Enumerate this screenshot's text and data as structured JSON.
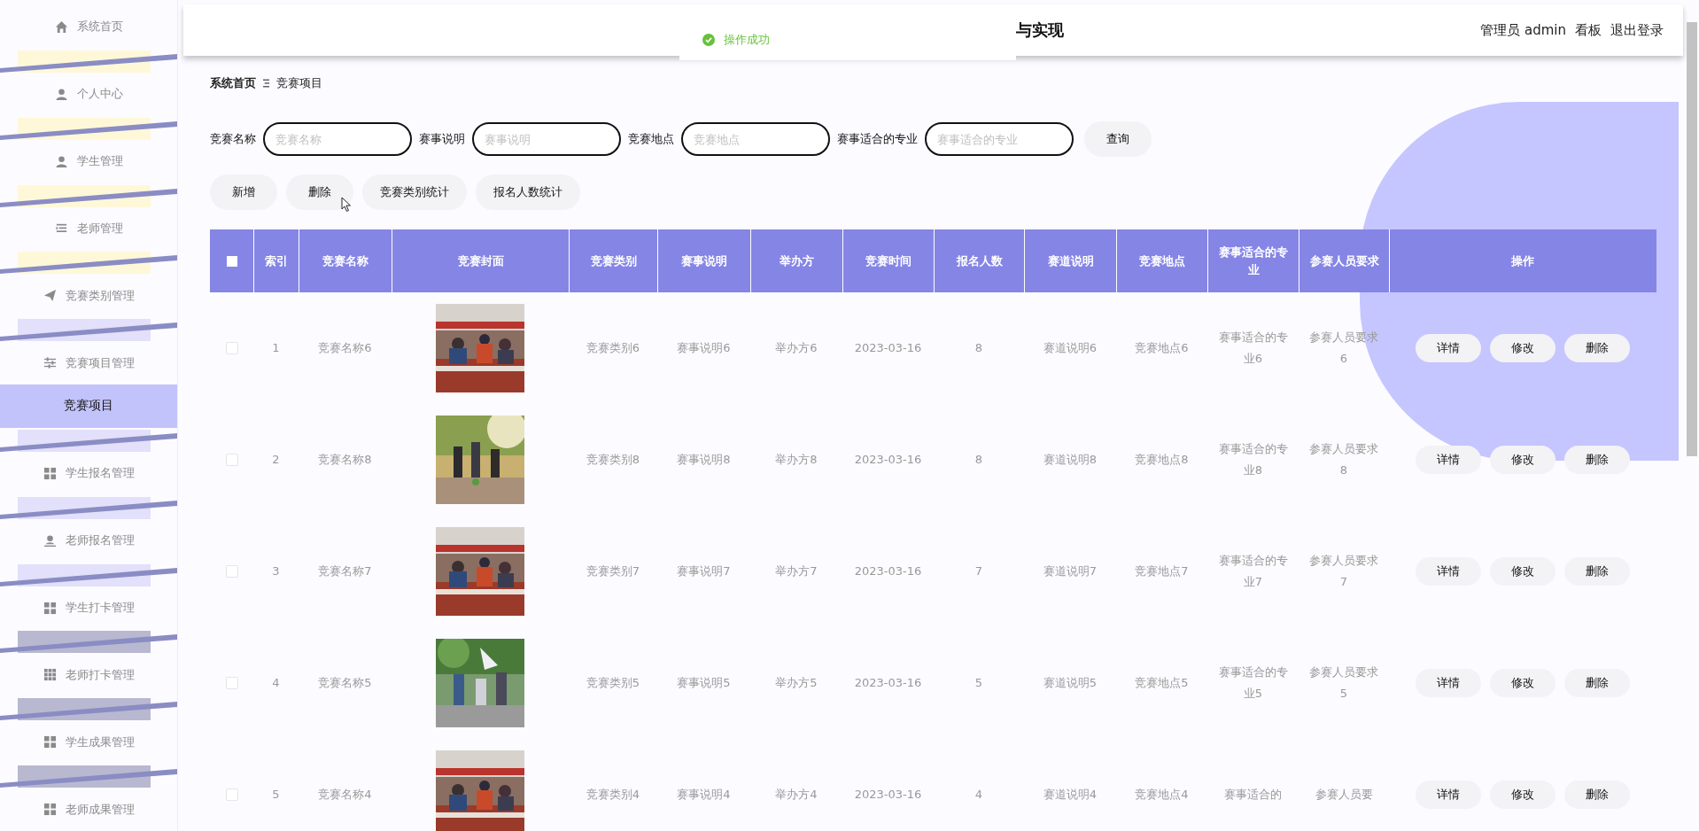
{
  "sidebar": {
    "items": [
      {
        "label": "系统首页",
        "selected": false
      },
      {
        "label": "个人中心",
        "selected": false
      },
      {
        "label": "学生管理",
        "selected": false
      },
      {
        "label": "老师管理",
        "selected": false
      },
      {
        "label": "竞赛类别管理",
        "selected": false
      },
      {
        "label": "竞赛项目管理",
        "selected": false,
        "expanded": true,
        "children": [
          {
            "label": "竞赛项目",
            "selected": true
          }
        ]
      },
      {
        "label": "学生报名管理",
        "selected": false
      },
      {
        "label": "老师报名管理",
        "selected": false
      },
      {
        "label": "学生打卡管理",
        "selected": false
      },
      {
        "label": "老师打卡管理",
        "selected": false
      },
      {
        "label": "学生成果管理",
        "selected": false
      },
      {
        "label": "老师成果管理",
        "selected": false
      }
    ]
  },
  "topbar": {
    "title": "与实现",
    "user": "管理员 admin",
    "links": [
      "看板",
      "退出登录"
    ]
  },
  "toast": {
    "message": "操作成功"
  },
  "breadcrumb": [
    "系统首页",
    "竞赛项目"
  ],
  "search": {
    "fields": [
      {
        "label": "竞赛名称",
        "placeholder": "竞赛名称"
      },
      {
        "label": "赛事说明",
        "placeholder": "赛事说明"
      },
      {
        "label": "竞赛地点",
        "placeholder": "竞赛地点"
      },
      {
        "label": "赛事适合的专业",
        "placeholder": "赛事适合的专业"
      }
    ],
    "button": "查询"
  },
  "actions": [
    "新增",
    "删除",
    "竞赛类别统计",
    "报名人数统计"
  ],
  "table": {
    "select_all": {
      "checked": false
    },
    "columns": [
      "索引",
      "竞赛名称",
      "竞赛封面",
      "竞赛类别",
      "赛事说明",
      "举办方",
      "竞赛时间",
      "报名人数",
      "赛道说明",
      "竞赛地点",
      "赛事适合的专业",
      "参赛人员要求",
      "操作"
    ],
    "rows": [
      {
        "checked": false,
        "index": "1",
        "name": "竞赛名称6",
        "cover": {
          "kind": "picture"
        },
        "category": "竞赛类别6",
        "description": "赛事说明6",
        "organizer": "举办方6",
        "date": "2023-03-16",
        "count": "8",
        "track": "赛道说明6",
        "location": "竞赛地点6",
        "major": "赛事适合的专业6",
        "requirement": "参赛人员要求6",
        "buttons": [
          "详情",
          "修改",
          "删除"
        ]
      },
      {
        "checked": false,
        "index": "2",
        "name": "竞赛名称8",
        "cover": {
          "kind": "picture"
        },
        "category": "竞赛类别8",
        "description": "赛事说明8",
        "organizer": "举办方8",
        "date": "2023-03-16",
        "count": "8",
        "track": "赛道说明8",
        "location": "竞赛地点8",
        "major": "赛事适合的专业8",
        "requirement": "参赛人员要求8",
        "buttons": [
          "详情",
          "修改",
          "删除"
        ]
      },
      {
        "checked": false,
        "index": "3",
        "name": "竞赛名称7",
        "cover": {
          "kind": "picture"
        },
        "category": "竞赛类别7",
        "description": "赛事说明7",
        "organizer": "举办方7",
        "date": "2023-03-16",
        "count": "7",
        "track": "赛道说明7",
        "location": "竞赛地点7",
        "major": "赛事适合的专业7",
        "requirement": "参赛人员要求7",
        "buttons": [
          "详情",
          "修改",
          "删除"
        ]
      },
      {
        "checked": false,
        "index": "4",
        "name": "竞赛名称5",
        "cover": {
          "kind": "picture"
        },
        "category": "竞赛类别5",
        "description": "赛事说明5",
        "organizer": "举办方5",
        "date": "2023-03-16",
        "count": "5",
        "track": "赛道说明5",
        "location": "竞赛地点5",
        "major": "赛事适合的专业5",
        "requirement": "参赛人员要求5",
        "buttons": [
          "详情",
          "修改",
          "删除"
        ]
      },
      {
        "checked": false,
        "index": "5",
        "name": "竞赛名称4",
        "cover": {
          "kind": "picture"
        },
        "category": "竞赛类别4",
        "description": "赛事说明4",
        "organizer": "举办方4",
        "date": "2023-03-16",
        "count": "4",
        "track": "赛道说明4",
        "location": "竞赛地点4",
        "major": "赛事适合的",
        "requirement": "参赛人员要",
        "buttons": [
          "详情",
          "修改",
          "删除"
        ]
      }
    ]
  }
}
